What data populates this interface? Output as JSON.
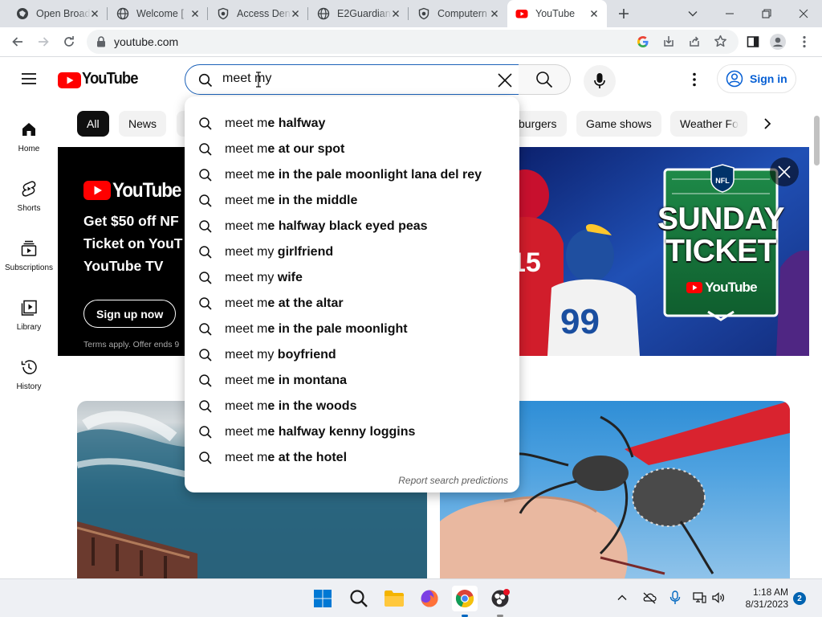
{
  "browser": {
    "tabs": [
      {
        "title": "Open Broad",
        "icon": "globe-dark-icon"
      },
      {
        "title": "Welcome [",
        "icon": "globe-icon"
      },
      {
        "title": "Access Den",
        "icon": "shield-icon"
      },
      {
        "title": "E2Guardian",
        "icon": "globe-icon"
      },
      {
        "title": "Computern",
        "icon": "shield-icon"
      },
      {
        "title": "YouTube",
        "icon": "youtube-icon"
      }
    ],
    "url": "youtube.com"
  },
  "youtube": {
    "logo_text": "YouTube",
    "search": {
      "value": "meet my",
      "placeholder": "Search"
    },
    "sign_in": "Sign in",
    "sidebar": [
      {
        "label": "Home",
        "icon": "home-icon"
      },
      {
        "label": "Shorts",
        "icon": "shorts-icon"
      },
      {
        "label": "Subscriptions",
        "icon": "subscriptions-icon"
      },
      {
        "label": "Library",
        "icon": "library-icon"
      },
      {
        "label": "History",
        "icon": "history-icon"
      }
    ],
    "chips": [
      "All",
      "News",
      "burgers",
      "Game shows",
      "Weather Fo"
    ],
    "banner": {
      "logo_text": "YouTube",
      "headline": "Get $50 off NF\nTicket on YouT\nYouTube TV",
      "button": "Sign up now",
      "terms": "Terms apply. Offer ends 9",
      "art_title_1": "SUNDAY",
      "art_title_2": "TICKET",
      "art_brand": "YouTube",
      "art_badge": "NFL"
    },
    "suggestions": [
      {
        "prefix": "meet m",
        "rest": "e halfway"
      },
      {
        "prefix": "meet m",
        "rest": "e at our spot"
      },
      {
        "prefix": "meet m",
        "rest": "e in the pale moonlight lana del rey"
      },
      {
        "prefix": "meet m",
        "rest": "e in the middle"
      },
      {
        "prefix": "meet m",
        "rest": "e halfway black eyed peas"
      },
      {
        "prefix": "meet my",
        "rest": " girlfriend"
      },
      {
        "prefix": "meet my",
        "rest": " wife"
      },
      {
        "prefix": "meet m",
        "rest": "e at the altar"
      },
      {
        "prefix": "meet m",
        "rest": "e in the pale moonlight"
      },
      {
        "prefix": "meet my",
        "rest": " boyfriend"
      },
      {
        "prefix": "meet m",
        "rest": "e in montana"
      },
      {
        "prefix": "meet m",
        "rest": "e in the woods"
      },
      {
        "prefix": "meet m",
        "rest": "e halfway kenny loggins"
      },
      {
        "prefix": "meet m",
        "rest": "e at the hotel"
      }
    ],
    "report": "Report search predictions"
  },
  "taskbar": {
    "time": "1:18 AM",
    "date": "8/31/2023",
    "notifications": "2"
  },
  "colors": {
    "youtube_red": "#ff0000",
    "link_blue": "#065fd4",
    "focus_blue": "#1c62b9"
  }
}
